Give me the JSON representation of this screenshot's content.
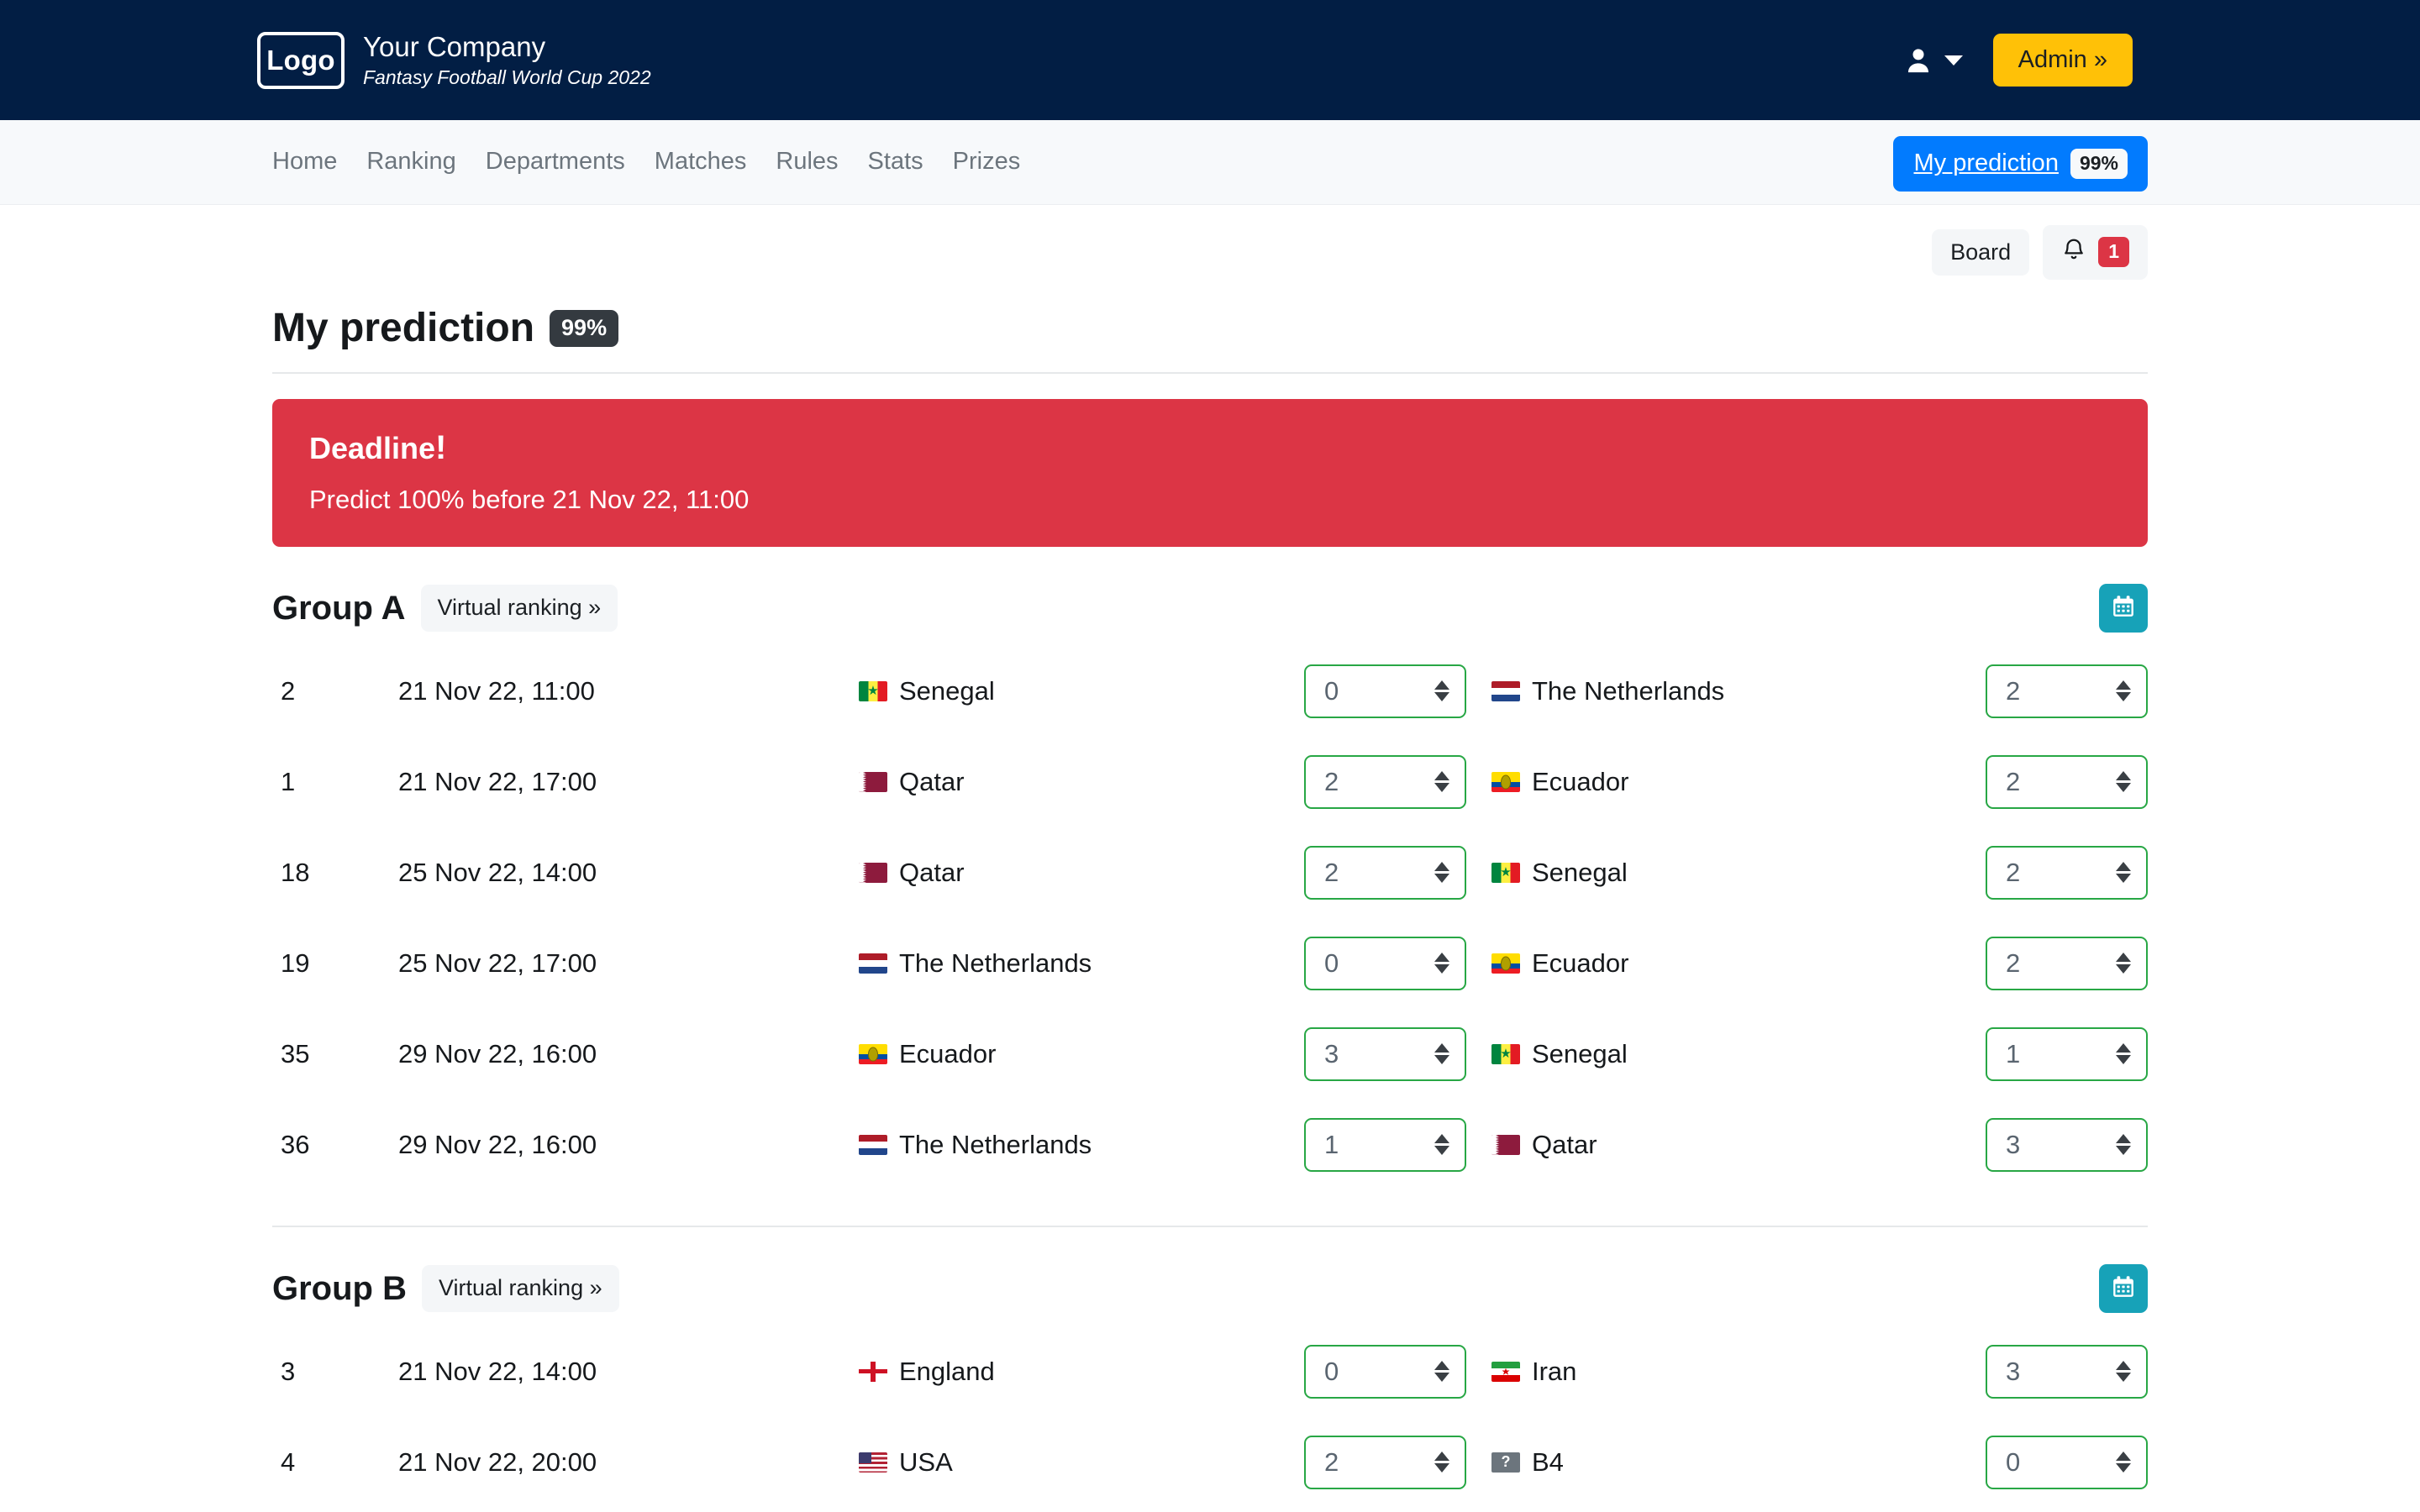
{
  "header": {
    "logo_text": "Logo",
    "company": "Your Company",
    "tagline": "Fantasy Football World Cup 2022",
    "user_icon": "user-icon",
    "admin_label": "Admin »",
    "accent_admin": "#ffc107",
    "bg": "#021e44"
  },
  "nav": {
    "links": [
      {
        "label": "Home"
      },
      {
        "label": "Ranking"
      },
      {
        "label": "Departments"
      },
      {
        "label": "Matches"
      },
      {
        "label": "Rules"
      },
      {
        "label": "Stats"
      },
      {
        "label": "Prizes"
      }
    ],
    "prediction_label": "My prediction",
    "prediction_pct": "99%",
    "accent": "#027bfe"
  },
  "subbar": {
    "board_label": "Board",
    "bell_icon": "bell-icon",
    "bell_count": "1",
    "bell_badge_color": "#dc3545"
  },
  "page": {
    "title": "My prediction",
    "pct": "99%"
  },
  "deadline": {
    "title": "Deadline",
    "bang": "!",
    "message": "Predict 100% before 21 Nov 22, 11:00",
    "color": "#dc3545"
  },
  "groups": [
    {
      "title": "Group A",
      "virtual_ranking_label": "Virtual ranking »",
      "calendar_icon": "calendar-icon",
      "matches": [
        {
          "no": "2",
          "date": "21 Nov 22, 11:00",
          "home": "Senegal",
          "home_flag": "senegal",
          "home_score": "0",
          "away": "The Netherlands",
          "away_flag": "netherlands",
          "away_score": "2"
        },
        {
          "no": "1",
          "date": "21 Nov 22, 17:00",
          "home": "Qatar",
          "home_flag": "qatar",
          "home_score": "2",
          "away": "Ecuador",
          "away_flag": "ecuador",
          "away_score": "2"
        },
        {
          "no": "18",
          "date": "25 Nov 22, 14:00",
          "home": "Qatar",
          "home_flag": "qatar",
          "home_score": "2",
          "away": "Senegal",
          "away_flag": "senegal",
          "away_score": "2"
        },
        {
          "no": "19",
          "date": "25 Nov 22, 17:00",
          "home": "The Netherlands",
          "home_flag": "netherlands",
          "home_score": "0",
          "away": "Ecuador",
          "away_flag": "ecuador",
          "away_score": "2"
        },
        {
          "no": "35",
          "date": "29 Nov 22, 16:00",
          "home": "Ecuador",
          "home_flag": "ecuador",
          "home_score": "3",
          "away": "Senegal",
          "away_flag": "senegal",
          "away_score": "1"
        },
        {
          "no": "36",
          "date": "29 Nov 22, 16:00",
          "home": "The Netherlands",
          "home_flag": "netherlands",
          "home_score": "1",
          "away": "Qatar",
          "away_flag": "qatar",
          "away_score": "3"
        }
      ]
    },
    {
      "title": "Group B",
      "virtual_ranking_label": "Virtual ranking »",
      "calendar_icon": "calendar-icon",
      "matches": [
        {
          "no": "3",
          "date": "21 Nov 22, 14:00",
          "home": "England",
          "home_flag": "england",
          "home_score": "0",
          "away": "Iran",
          "away_flag": "iran",
          "away_score": "3"
        },
        {
          "no": "4",
          "date": "21 Nov 22, 20:00",
          "home": "USA",
          "home_flag": "usa",
          "home_score": "2",
          "away": "B4",
          "away_flag": "unknown",
          "away_score": "0"
        }
      ]
    }
  ]
}
